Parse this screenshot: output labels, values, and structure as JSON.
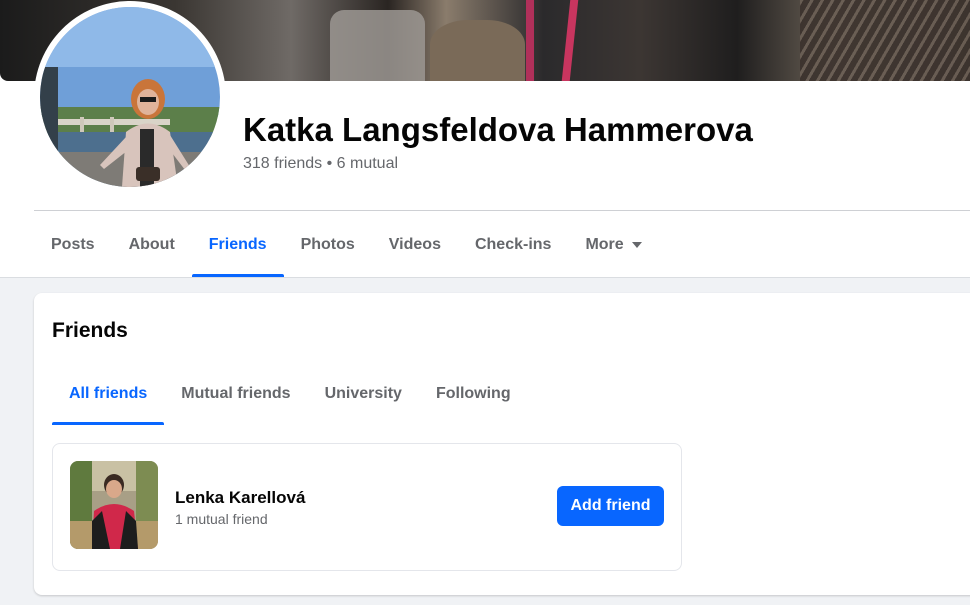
{
  "profile": {
    "name": "Katka Langsfeldova Hammerova",
    "friends_summary": "318 friends • 6 mutual"
  },
  "tabs": [
    {
      "label": "Posts",
      "active": false
    },
    {
      "label": "About",
      "active": false
    },
    {
      "label": "Friends",
      "active": true
    },
    {
      "label": "Photos",
      "active": false
    },
    {
      "label": "Videos",
      "active": false
    },
    {
      "label": "Check-ins",
      "active": false
    },
    {
      "label": "More",
      "active": false,
      "icon": "caret-down-icon"
    }
  ],
  "friends_section": {
    "title": "Friends",
    "subtabs": [
      {
        "label": "All friends",
        "active": true
      },
      {
        "label": "Mutual friends",
        "active": false
      },
      {
        "label": "University",
        "active": false
      },
      {
        "label": "Following",
        "active": false
      }
    ],
    "list": [
      {
        "name": "Lenka Karellová",
        "mutual": "1 mutual friend",
        "button_label": "Add friend"
      }
    ]
  },
  "colors": {
    "accent": "#0866ff",
    "secondary_text": "#65676b",
    "page_background": "#f0f2f5"
  }
}
